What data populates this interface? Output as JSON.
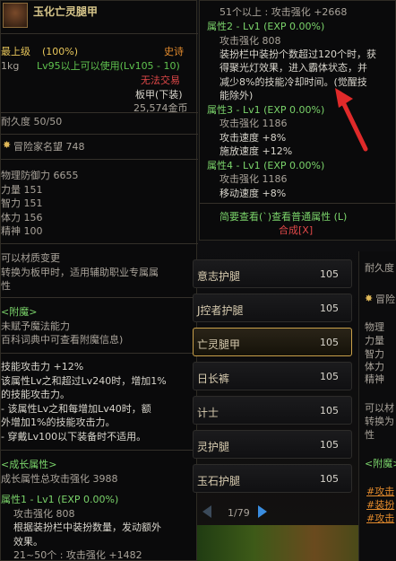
{
  "left_tooltip": {
    "item_name": "玉化亡灵腿甲",
    "max_level": "最上级",
    "max_level_pct": "(100%)",
    "rarity": "史诗",
    "weight": "1kg",
    "level_req": "Lv95以上可以使用(Lv105 - 10)",
    "trade": "无法交易",
    "slot": "板甲(下装)",
    "gold": "25,574金币",
    "durability": "耐久度 50/50",
    "adventurer_fame": "冒险家名望 748",
    "stats": [
      "物理防御力 6655",
      "力量 151",
      "智力 151",
      "体力 156",
      "精神 100"
    ],
    "material_change": "可以材质变更",
    "convert_note": "转换为板甲时，适用辅助职业专属属",
    "convert_note2": "性",
    "enchant_header": "<附魔>",
    "enchant_1": "未赋予魔法能力",
    "enchant_2": "百科词典中可查看附魔信息)",
    "skill_atk": "技能攻击力 +12%",
    "skill_lines": [
      "该属性Lv之和超过Lv240时，增加1%",
      "的技能攻击力。",
      "- 该属性Lv之和每增加Lv40时，额",
      "外增加1%的技能攻击力。",
      "- 穿戴Lv100以下装备时不适用。"
    ],
    "growth_header": "<成长属性>",
    "growth_total": "成长属性总攻击强化 3988",
    "attr1_header": "属性1 - Lv1 (EXP 0.00%)",
    "attr1_line1": "攻击强化 808",
    "attr1_line2": "根据装扮栏中装扮数量，发动额外",
    "attr1_line3": "效果。",
    "attr1_line4": "21~50个 : 攻击强化 +1482"
  },
  "right_tooltip": {
    "line_top": "51个以上 : 攻击强化 +2668",
    "attr2_header": "属性2 - Lv1 (EXP 0.00%)",
    "attr2_atk": "攻击强化 808",
    "attr2_desc": [
      "装扮栏中装扮个数超过120个时，获",
      "得聚光灯效果，进入霸体状态，并",
      "减少8%的技能冷却时间。(觉醒技",
      "能除外)"
    ],
    "attr3_header": "属性3 - Lv1 (EXP 0.00%)",
    "attr3_lines": [
      "攻击强化 1186",
      "攻击速度 +8%",
      "施放速度 +12%"
    ],
    "attr4_header": "属性4 - Lv1 (EXP 0.00%)",
    "attr4_lines": [
      "攻击强化 1186",
      "移动速度 +8%"
    ],
    "brief_view": "简要查看(`)查看普通属性 (L)",
    "synth": "合成[X]"
  },
  "item_list": {
    "items": [
      {
        "name": "意志护腿",
        "level": "105"
      },
      {
        "name": "J控者护腿",
        "level": "105"
      },
      {
        "name": "亡灵腿甲",
        "level": "105"
      },
      {
        "name": "日长裤",
        "level": "105"
      },
      {
        "name": "计士",
        "level": "105"
      },
      {
        "name": "灵护腿",
        "level": "105"
      },
      {
        "name": "玉石护腿",
        "level": "105"
      }
    ],
    "page": "1/79"
  },
  "right_edge": {
    "durability": "耐久度",
    "adventurer": "冒险",
    "stats": [
      "物理",
      "力量",
      "智力",
      "体力",
      "精神"
    ],
    "material": "可以材",
    "convert": "转换为",
    "convert2": "性",
    "enchant": "<附魔>",
    "enchant_lines": [
      "#攻击",
      "#装扮",
      "#攻击"
    ]
  },
  "colors": {
    "arrow": "#e02a2a",
    "selection_border": "#c9a04a"
  }
}
